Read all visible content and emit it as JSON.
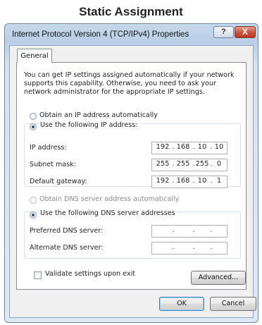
{
  "heading": "Static Assignment",
  "window": {
    "title": "Internet Protocol Version 4 (TCP/IPv4) Properties",
    "help_glyph": "?",
    "close_glyph": "X"
  },
  "tabs": [
    {
      "label": "General",
      "selected": true
    }
  ],
  "intro_text": "You can get IP settings assigned automatically if your network supports this capability. Otherwise, you need to ask your network administrator for the appropriate IP settings.",
  "ip_section": {
    "auto_label": "Obtain an IP address automatically",
    "auto_selected": false,
    "manual_label": "Use the following IP address:",
    "manual_selected": true,
    "fields": [
      {
        "label": "IP address:",
        "octets": [
          "192",
          "168",
          "10",
          "10"
        ]
      },
      {
        "label": "Subnet mask:",
        "octets": [
          "255",
          "255",
          "255",
          "0"
        ]
      },
      {
        "label": "Default gateway:",
        "octets": [
          "192",
          "168",
          "10",
          "1"
        ]
      }
    ]
  },
  "dns_section": {
    "auto_label": "Obtain DNS server address automatically",
    "auto_selected": false,
    "auto_enabled": false,
    "manual_label": "Use the following DNS server addresses",
    "manual_selected": true,
    "fields": [
      {
        "label": "Preferred DNS server:",
        "octets": [
          "",
          "",
          "",
          ""
        ]
      },
      {
        "label": "Alternate DNS server:",
        "octets": [
          "",
          "",
          "",
          ""
        ]
      }
    ]
  },
  "validate": {
    "label": "Validate settings upon exit",
    "checked": false
  },
  "buttons": {
    "advanced": "Advanced...",
    "ok": "OK",
    "cancel": "Cancel"
  }
}
